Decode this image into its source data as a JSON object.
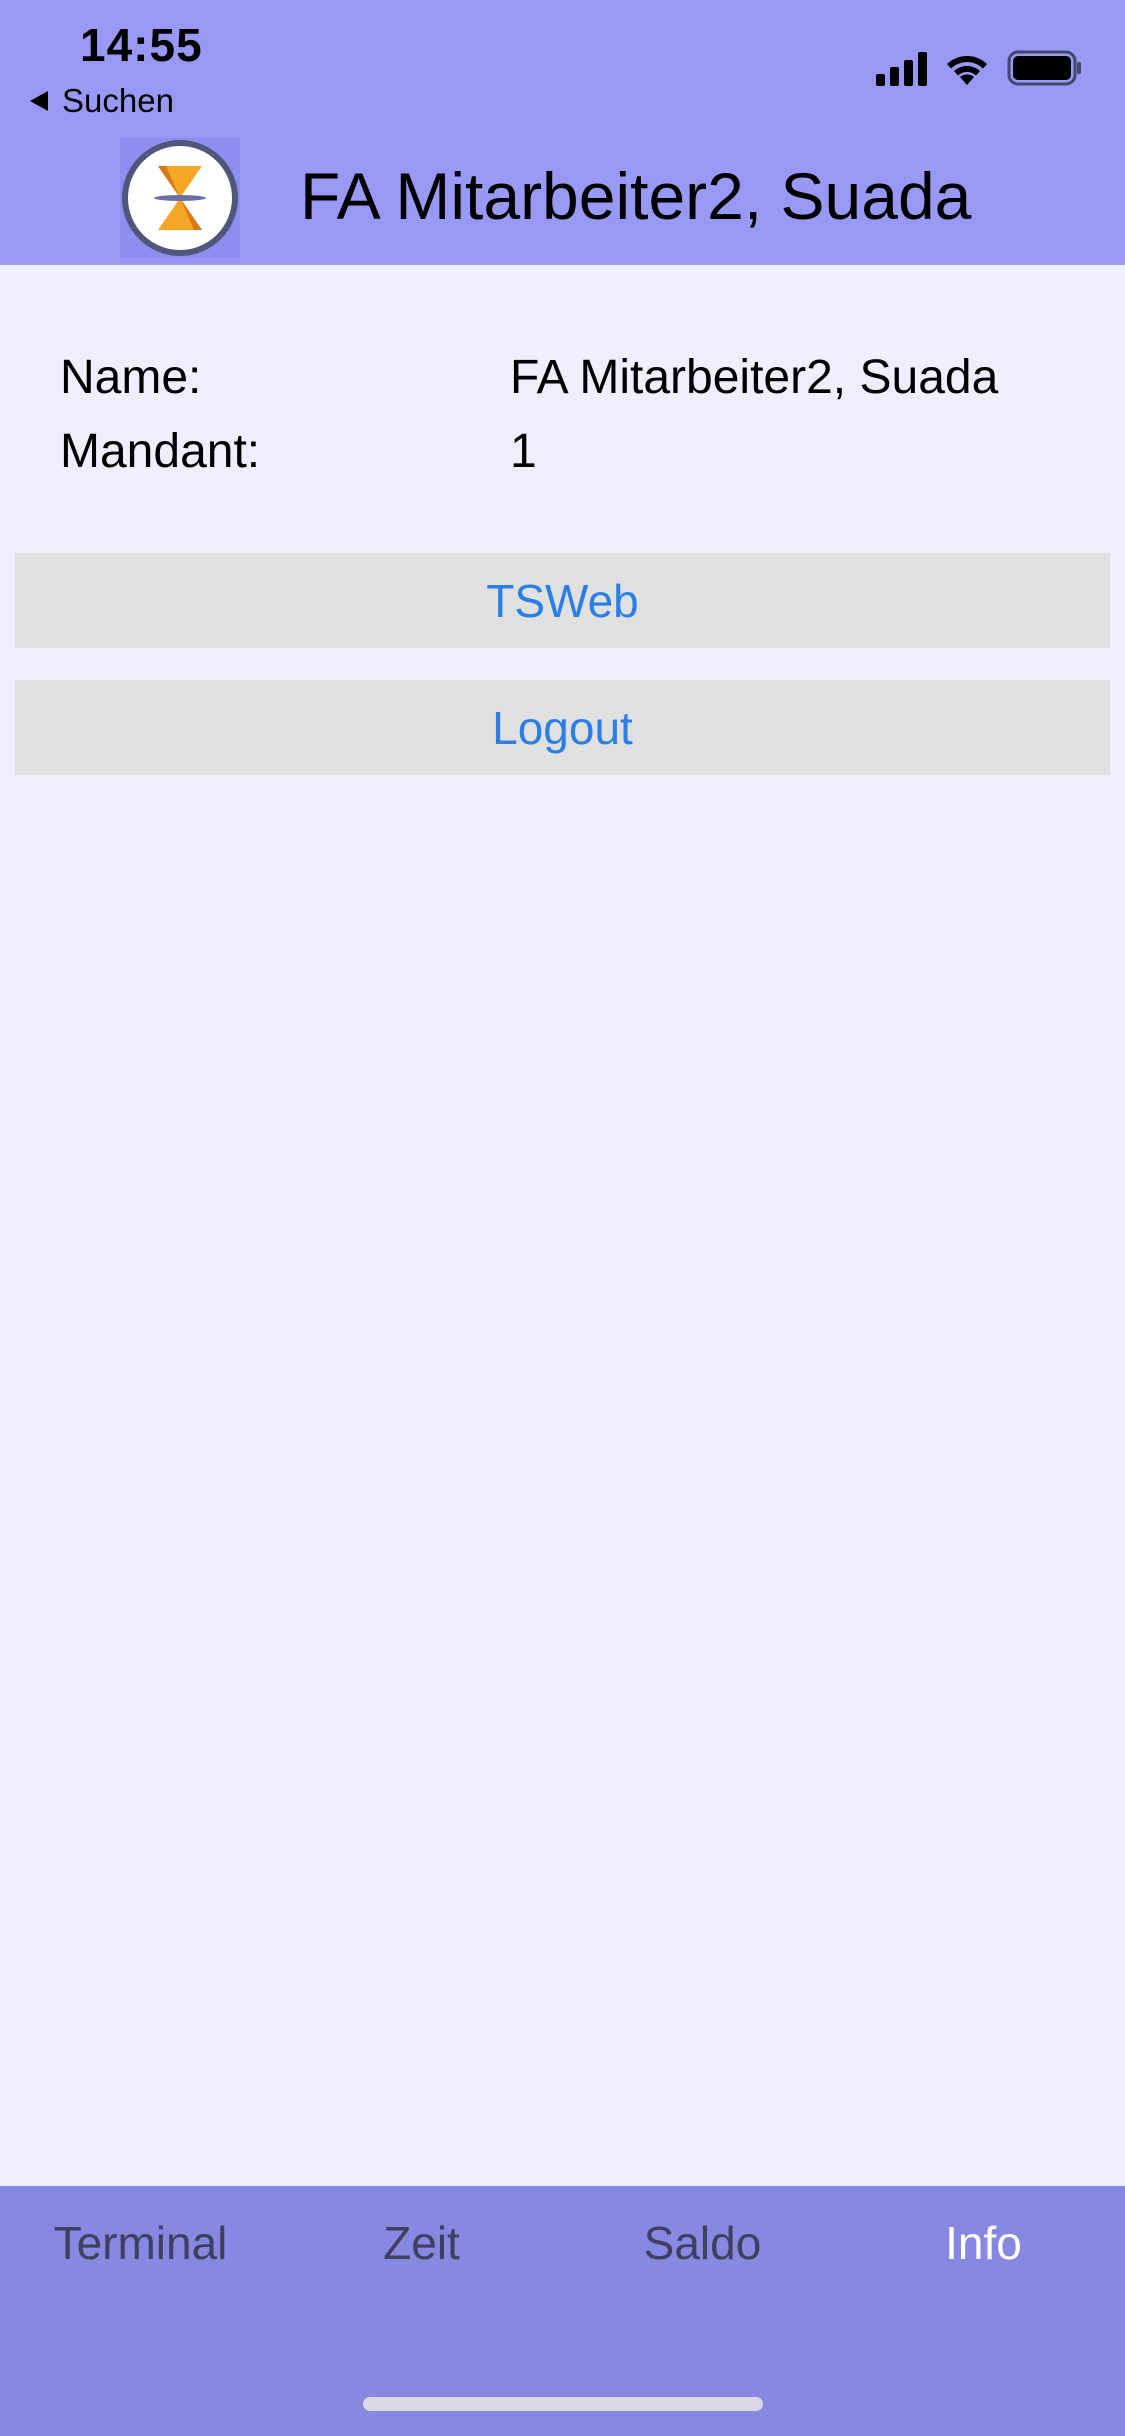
{
  "status_bar": {
    "time": "14:55",
    "back_label": "Suchen",
    "icons": [
      "cellular-signal-icon",
      "wifi-icon",
      "battery-icon"
    ]
  },
  "nav": {
    "logo_icon": "hourglass-logo-icon",
    "title": "FA Mitarbeiter2, Suada"
  },
  "info": {
    "name_label": "Name:",
    "name_value": "FA Mitarbeiter2, Suada",
    "mandant_label": "Mandant:",
    "mandant_value": "1"
  },
  "buttons": {
    "tsweb": "TSWeb",
    "logout": "Logout"
  },
  "tabs": [
    {
      "label": "Terminal",
      "active": false
    },
    {
      "label": "Zeit",
      "active": false
    },
    {
      "label": "Saldo",
      "active": false
    },
    {
      "label": "Info",
      "active": true
    }
  ],
  "colors": {
    "header_bg": "#9899f4",
    "content_bg": "#efeefc",
    "button_bg": "#e0e0e0",
    "link_blue": "#2a7fe6",
    "tabbar_bg": "#8788e2",
    "tab_active": "#ffffff",
    "tab_inactive": "#3f4060",
    "logo_orange": "#f5a623"
  }
}
